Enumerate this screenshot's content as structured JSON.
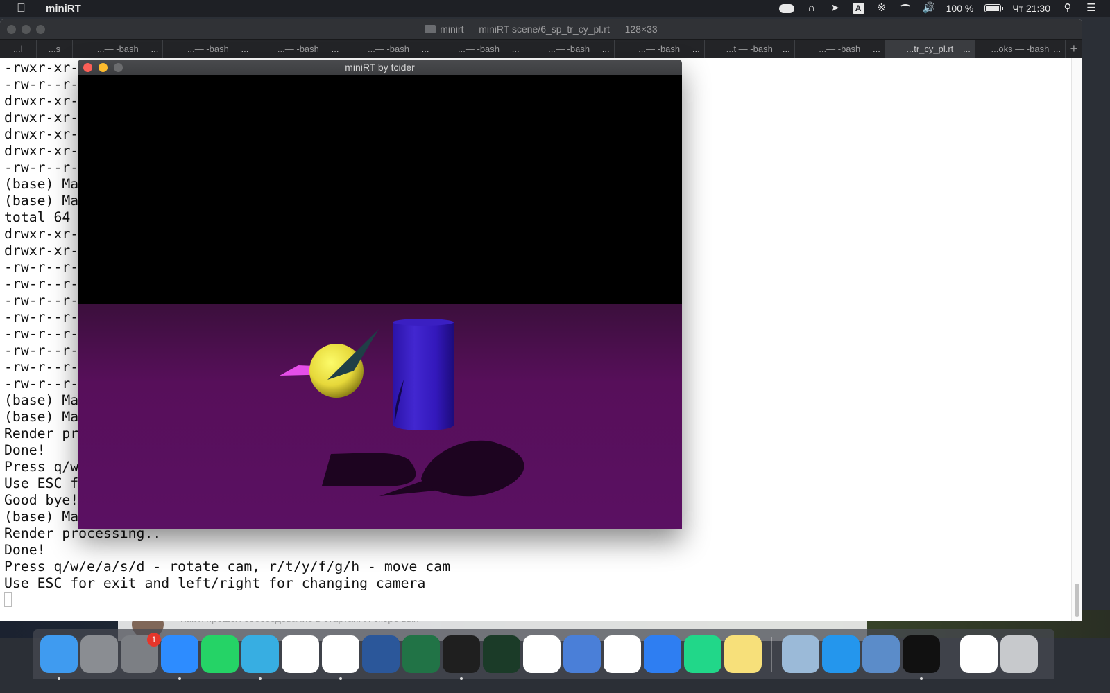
{
  "menubar": {
    "app_name": "miniRT",
    "battery": "100 %",
    "clock": "Чт 21:30",
    "input_source": "A",
    "battery_fill": 1.0
  },
  "terminal": {
    "title": "minirt — miniRT scene/6_sp_tr_cy_pl.rt — 128×33",
    "tabs": [
      {
        "label": "...l"
      },
      {
        "label": "...s"
      },
      {
        "label": "...— -bash"
      },
      {
        "label": "...— -bash"
      },
      {
        "label": "...— -bash"
      },
      {
        "label": "...— -bash"
      },
      {
        "label": "...— -bash"
      },
      {
        "label": "...— -bash"
      },
      {
        "label": "...— -bash"
      },
      {
        "label": "...t — -bash"
      },
      {
        "label": "...— -bash"
      },
      {
        "label": "...tr_cy_pl.rt"
      },
      {
        "label": "...oks — -bash"
      }
    ],
    "lines": [
      "-rwxr-xr-",
      "-rw-r--r-",
      "drwxr-xr-",
      "drwxr-xr-",
      "drwxr-xr-",
      "drwxr-xr-",
      "-rw-r--r-",
      "(base) Ma",
      "(base) Ma",
      "total 64",
      "drwxr-xr-",
      "drwxr-xr-",
      "-rw-r--r-",
      "-rw-r--r-",
      "-rw-r--r-",
      "-rw-r--r-",
      "-rw-r--r-",
      "-rw-r--r-",
      "-rw-r--r-",
      "-rw-r--r-",
      "(base) Ma",
      "(base) Ma",
      "Render pr",
      "Done!",
      "Press q/w",
      "Use ESC f",
      "Good bye!",
      "(base) Ma",
      "Render processing..",
      "Done!",
      "Press q/w/e/a/s/d - rotate cam, r/t/y/f/g/h - move cam",
      "Use ESC for exit and left/right for changing camera"
    ]
  },
  "minirt": {
    "title": "miniRT by tcider"
  },
  "background": {
    "notification_text": "Как я прошёл собеседование в стартап. Я скоро вых"
  },
  "dock": {
    "items": [
      {
        "name": "Finder",
        "icon": "finder-icon",
        "color": "#3f9bf0",
        "running": true
      },
      {
        "name": "Launchpad",
        "icon": "rocket-icon",
        "color": "#8a8d92",
        "running": false
      },
      {
        "name": "System Preferences",
        "icon": "gear-icon",
        "color": "#7c7f84",
        "running": false,
        "badge": "1"
      },
      {
        "name": "Zoom",
        "icon": "camera-icon",
        "color": "#2d8cff",
        "running": true
      },
      {
        "name": "WhatsApp",
        "icon": "phone-icon",
        "color": "#25d366",
        "running": false
      },
      {
        "name": "Telegram",
        "icon": "paper-plane-icon",
        "color": "#37aee2",
        "running": true
      },
      {
        "name": "Yandex Browser",
        "icon": "y-icon",
        "color": "#ffffff",
        "running": false
      },
      {
        "name": "Chrome",
        "icon": "chrome-icon",
        "color": "#ffffff",
        "running": true
      },
      {
        "name": "Word",
        "icon": "w-icon",
        "color": "#2b579a",
        "running": false
      },
      {
        "name": "Excel",
        "icon": "x-icon",
        "color": "#217346",
        "running": false
      },
      {
        "name": "Terminal",
        "icon": "terminal-icon",
        "color": "#1f1f1f",
        "running": true
      },
      {
        "name": "Quartz",
        "icon": "ring-icon",
        "color": "#1b3b28",
        "running": false
      },
      {
        "name": "VS Code",
        "icon": "vscode-icon",
        "color": "#ffffff",
        "running": false
      },
      {
        "name": "Mail Client",
        "icon": "saucer-icon",
        "color": "#4a7fd8",
        "running": false
      },
      {
        "name": "Slack",
        "icon": "slack-icon",
        "color": "#ffffff",
        "running": false
      },
      {
        "name": "Safari",
        "icon": "compass-icon",
        "color": "#2e7ef2",
        "running": false
      },
      {
        "name": "PyCharm",
        "icon": "pc-icon",
        "color": "#21d789",
        "running": false
      },
      {
        "name": "Notes",
        "icon": "notepad-icon",
        "color": "#f7e07a",
        "running": false
      },
      {
        "name": "Preview",
        "icon": "photos-icon",
        "color": "#9bbad8",
        "running": false
      },
      {
        "name": "Docker",
        "icon": "whale-icon",
        "color": "#2496ed",
        "running": false
      },
      {
        "name": "VirtualBox",
        "icon": "cube-icon",
        "color": "#5b8cc9",
        "running": false
      },
      {
        "name": "exec",
        "icon": "exec-icon",
        "color": "#111111",
        "running": true
      },
      {
        "name": "Documents",
        "icon": "document-icon",
        "color": "#ffffff",
        "running": false
      },
      {
        "name": "Trash",
        "icon": "trash-icon",
        "color": "#c7c9cc",
        "running": false
      }
    ]
  }
}
